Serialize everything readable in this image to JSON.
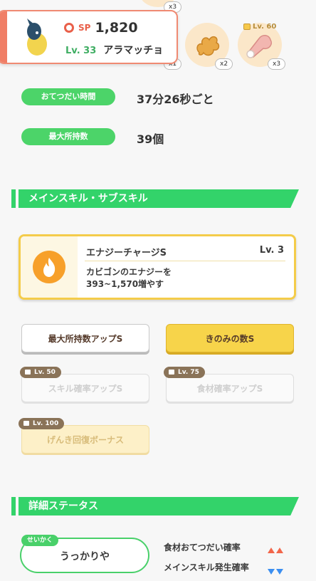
{
  "header": {
    "sp_label": "SP",
    "sp_value": "1,820",
    "level": "Lv. 33",
    "name": "アラマッチョ",
    "top_badge": "x3",
    "items": [
      {
        "icon": "seed-icon",
        "count": "x1"
      },
      {
        "icon": "ginger-icon",
        "count": "x2"
      },
      {
        "icon": "meat-icon",
        "count": "x3",
        "lock_level": "Lv. 60"
      }
    ]
  },
  "info": {
    "help_time_label": "おてつだい時間",
    "help_time_value": "37分26秒ごと",
    "max_carry_label": "最大所持数",
    "max_carry_value": "39個"
  },
  "skills_section": {
    "title": "メインスキル・サブスキル",
    "main_skill": {
      "icon": "fire-icon",
      "name": "エナジーチャージS",
      "level": "Lv. 3",
      "description": "カビゴンのエナジーを\n393~1,570増やす",
      "accent": "#f7a02a"
    },
    "sub_skills": [
      {
        "label": "最大所持数アップS",
        "state": "unlocked"
      },
      {
        "label": "きのみの数S",
        "state": "unlocked-gold"
      },
      {
        "label": "スキル確率アップS",
        "state": "locked",
        "lock_level": "Lv. 50"
      },
      {
        "label": "食材確率アップS",
        "state": "locked",
        "lock_level": "Lv. 75"
      },
      {
        "label": "げんき回復ボーナス",
        "state": "locked-gold",
        "lock_level": "Lv. 100"
      }
    ]
  },
  "detail_section": {
    "title": "詳細ステータス",
    "nature_tag": "せいかく",
    "nature_value": "うっかりや",
    "effects": [
      {
        "label": "食材おてつだい確率",
        "direction": "up",
        "color": "#f2664a"
      },
      {
        "label": "メインスキル発生確率",
        "direction": "down",
        "color": "#3b8ef0"
      }
    ]
  }
}
